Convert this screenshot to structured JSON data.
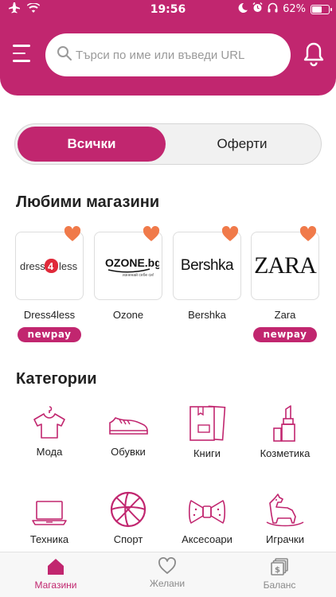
{
  "status_bar": {
    "time": "19:56",
    "battery": "62%",
    "battery_level": 0.62
  },
  "header": {
    "search_placeholder": "Търси по име или въведи URL"
  },
  "segment": {
    "all_label": "Всички",
    "offers_label": "Оферти"
  },
  "favorites": {
    "title": "Любими магазини",
    "badge_label": "newpay",
    "stores": [
      {
        "name": "Dress4less",
        "logo": "dress4less",
        "newpay": true
      },
      {
        "name": "Ozone",
        "logo": "OZONE.bg",
        "logo_tagline": "изненай себе си!",
        "newpay": false
      },
      {
        "name": "Bershka",
        "logo": "Bershka",
        "newpay": false
      },
      {
        "name": "Zara",
        "logo": "ZARA",
        "newpay": true
      }
    ]
  },
  "categories": {
    "title": "Категории",
    "items": [
      {
        "label": "Мода",
        "icon": "tshirt-icon"
      },
      {
        "label": "Обувки",
        "icon": "shoe-icon"
      },
      {
        "label": "Книги",
        "icon": "books-icon"
      },
      {
        "label": "Козметика",
        "icon": "lipstick-icon"
      },
      {
        "label": "Техника",
        "icon": "laptop-icon"
      },
      {
        "label": "Спорт",
        "icon": "basketball-icon"
      },
      {
        "label": "Аксесоари",
        "icon": "bowtie-icon"
      },
      {
        "label": "Играчки",
        "icon": "rocking-horse-icon"
      }
    ]
  },
  "tabbar": {
    "tabs": [
      {
        "label": "Магазини",
        "icon": "store-icon",
        "active": true
      },
      {
        "label": "Желани",
        "icon": "heart-outline-icon",
        "active": false
      },
      {
        "label": "Баланс",
        "icon": "balance-icon",
        "active": false
      }
    ]
  },
  "colors": {
    "brand": "#c1266f",
    "heart": "#f07a4a",
    "inactive_tab": "#8a8a8a"
  }
}
